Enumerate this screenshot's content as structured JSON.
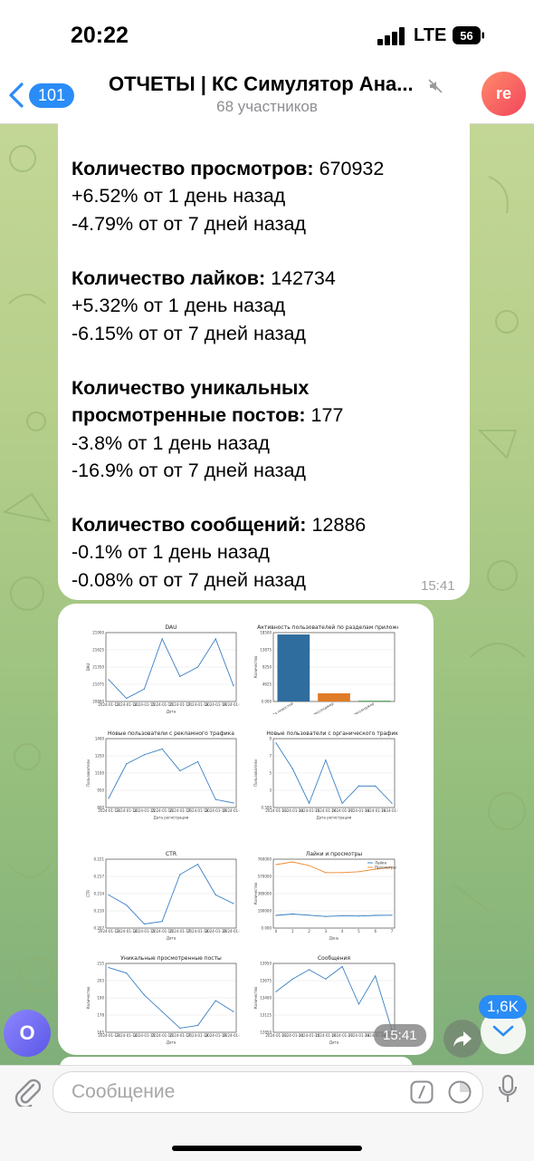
{
  "status": {
    "time": "20:22",
    "network": "LTE",
    "battery": "56"
  },
  "header": {
    "back_count": "101",
    "title": "ОТЧЕТЫ | КС Симулятор Ана...",
    "subtitle": "68 участников",
    "avatar": "re"
  },
  "message1": {
    "views_label": "Количество просмотров:",
    "views_value": " 670932",
    "views_d1": "+6.52% от 1 день назад",
    "views_d7": "-4.79% от от 7 дней назад",
    "likes_label": "Количество лайков:",
    "likes_value": " 142734",
    "likes_d1": "+5.32% от 1 день назад",
    "likes_d7": "-6.15% от от 7 дней назад",
    "posts_label1": "Количество уникальных",
    "posts_label2": "просмотренные постов:",
    "posts_value": " 177",
    "posts_d1": "-3.8% от 1 день назад",
    "posts_d7": "-16.9% от от 7 дней назад",
    "msgs_label": "Количество сообщений:",
    "msgs_value": " 12886",
    "msgs_d1": "-0.1% от 1 день назад",
    "msgs_d7": "-0.08% от от 7 дней назад",
    "time": "15:41"
  },
  "message2": {
    "time": "15:41"
  },
  "chart_data": [
    {
      "type": "line",
      "title": "DAU",
      "ylabel": "DAU",
      "xlabel": "Дата",
      "x": [
        "2024-01-13",
        "2024-01-14",
        "2024-01-15",
        "2024-01-16",
        "2024-01-17",
        "2024-01-18",
        "2024-01-19",
        "2024-01-20"
      ],
      "values": [
        21150,
        20850,
        21000,
        21800,
        21200,
        21350,
        21800,
        21050
      ],
      "ylim": [
        20800,
        21900
      ]
    },
    {
      "type": "bar",
      "title": "Активность пользователей по разделам приложения",
      "ylabel": "Количество",
      "categories": [
        "Только лента новостей",
        "Только мессенджер",
        "И лента, и мессенджер"
      ],
      "values": [
        18000,
        2200,
        200
      ],
      "colors": [
        "#2f6d9e",
        "#e07b27",
        "#3f9b3f"
      ],
      "ylim": [
        0,
        18500
      ]
    },
    {
      "type": "line",
      "title": "Новые пользователи с рекламного трафика",
      "ylabel": "Пользователи",
      "xlabel": "Дата регистрации",
      "x": [
        "2024-01-13",
        "2024-01-14",
        "2024-01-15",
        "2024-01-16",
        "2024-01-17",
        "2024-01-18",
        "2024-01-19",
        "2024-01-20"
      ],
      "values": [
        880,
        1180,
        1260,
        1310,
        1120,
        1200,
        870,
        840
      ],
      "ylim": [
        800,
        1400
      ]
    },
    {
      "type": "line",
      "title": "Новые пользователи с органического трафика",
      "ylabel": "Пользователи",
      "xlabel": "Дата регистрации",
      "x": [
        "2024-01-13",
        "2024-01-14",
        "2024-01-15",
        "2024-01-16",
        "2024-01-17",
        "2024-01-18",
        "2024-01-19",
        "2024-01-20"
      ],
      "values": [
        8,
        5,
        1,
        6,
        1,
        3,
        3,
        1
      ],
      "ylim": [
        0.5,
        8.5
      ]
    },
    {
      "type": "line",
      "title": "CTR",
      "ylabel": "CTR",
      "xlabel": "Дата",
      "x": [
        "2024-01-13",
        "2024-01-14",
        "2024-01-15",
        "2024-01-16",
        "2024-01-17",
        "2024-01-18",
        "2024-01-19",
        "2024-01-20"
      ],
      "values": [
        0.2135,
        0.2115,
        0.2078,
        0.2083,
        0.2175,
        0.2195,
        0.2135,
        0.2118
      ],
      "ylim": [
        0.207,
        0.2205
      ]
    },
    {
      "type": "line",
      "title": "Лайки и просмотры",
      "ylabel": "Количество",
      "xlabel": "День",
      "x": [
        0,
        1,
        2,
        3,
        4,
        5,
        6,
        7
      ],
      "series": [
        {
          "name": "Лайки",
          "values": [
            140000,
            155000,
            142000,
            128000,
            136000,
            133000,
            140000,
            142000
          ],
          "color": "#2f7bbd"
        },
        {
          "name": "Просмотры",
          "values": [
            700000,
            730000,
            690000,
            612000,
            612000,
            622000,
            650000,
            671000
          ],
          "color": "#f08a2c"
        }
      ],
      "ylim": [
        0,
        760000
      ]
    },
    {
      "type": "line",
      "title": "Уникальные просмотренные посты",
      "ylabel": "Количество",
      "xlabel": "Дата",
      "x": [
        "2024-01-13",
        "2024-01-14",
        "2024-01-15",
        "2024-01-16",
        "2024-01-17",
        "2024-01-18",
        "2024-01-19",
        "2024-01-20"
      ],
      "values": [
        212,
        208,
        192,
        180,
        168,
        170,
        188,
        180
      ],
      "ylim": [
        165,
        215
      ]
    },
    {
      "type": "line",
      "title": "Сообщения",
      "ylabel": "Количество",
      "xlabel": "Дата",
      "x": [
        "2024-01-13",
        "2024-01-14",
        "2024-01-15",
        "2024-01-16",
        "2024-01-17",
        "2024-01-18",
        "2024-01-19",
        "2024-01-20"
      ],
      "values": [
        13500,
        13700,
        13850,
        13700,
        13900,
        13300,
        13750,
        12886
      ],
      "ylim": [
        12850,
        13950
      ]
    }
  ],
  "scroll": {
    "unread": "1,6K"
  },
  "user_avatar": "O",
  "input": {
    "placeholder": "Сообщение"
  }
}
